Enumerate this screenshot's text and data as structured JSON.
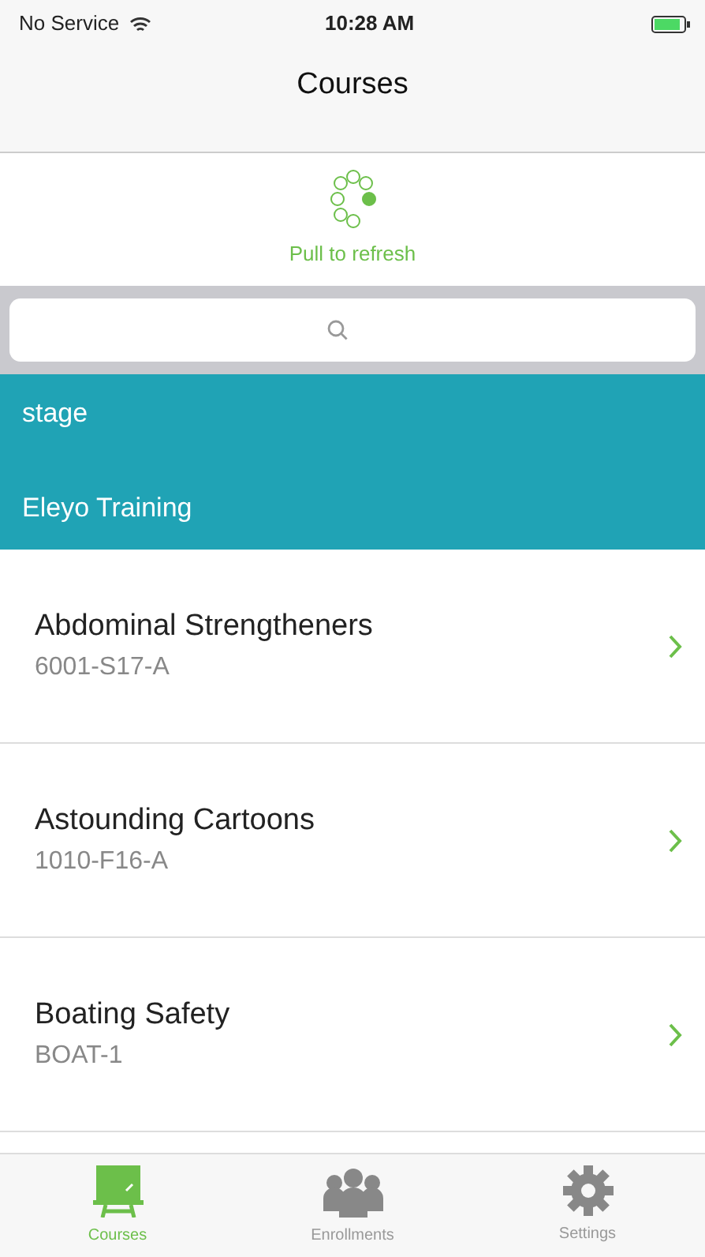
{
  "status_bar": {
    "carrier": "No Service",
    "time": "10:28 AM"
  },
  "nav_bar": {
    "title": "Courses"
  },
  "refresh": {
    "label": "Pull to refresh"
  },
  "header_section": {
    "lines": [
      "stage",
      "Eleyo Training"
    ]
  },
  "courses": [
    {
      "title": "Abdominal Strengtheners",
      "code": "6001-S17-A"
    },
    {
      "title": "Astounding Cartoons",
      "code": "1010-F16-A"
    },
    {
      "title": "Boating Safety",
      "code": "BOAT-1"
    }
  ],
  "tabs": [
    {
      "label": "Courses",
      "selected": true
    },
    {
      "label": "Enrollments",
      "selected": false
    },
    {
      "label": "Settings",
      "selected": false
    }
  ]
}
